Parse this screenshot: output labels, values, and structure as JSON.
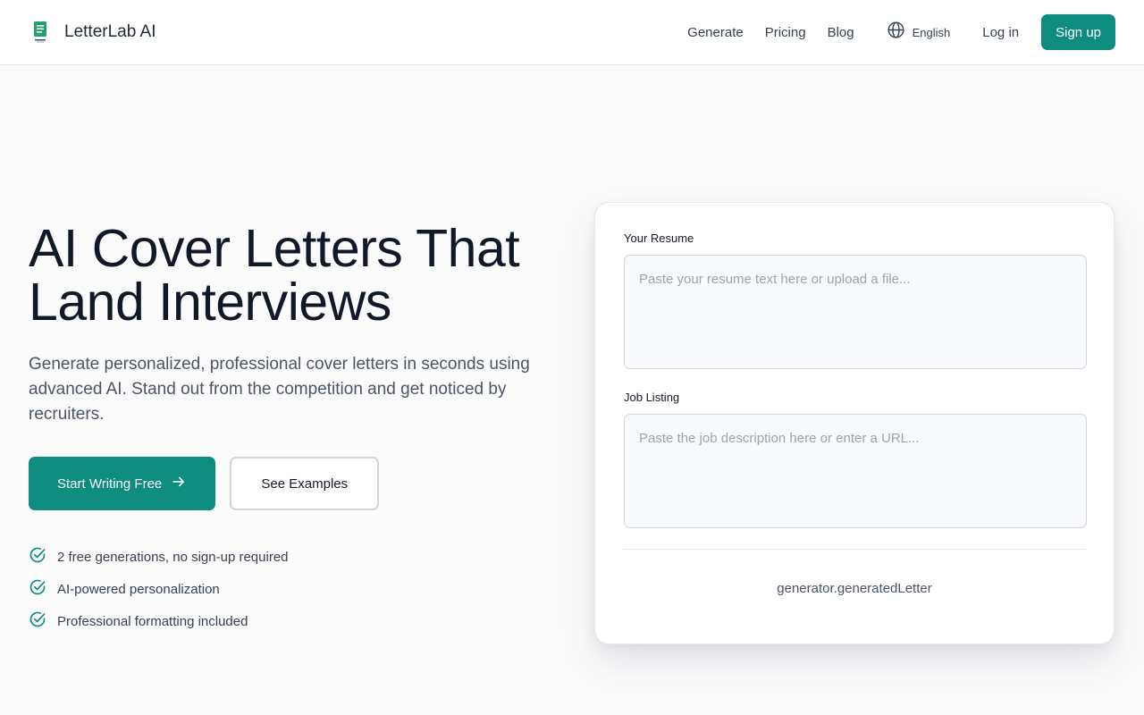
{
  "header": {
    "brand_name": "LetterLab AI",
    "nav": [
      "Generate",
      "Pricing",
      "Blog"
    ],
    "language": "English",
    "login": "Log in",
    "signup": "Sign up"
  },
  "hero": {
    "title_line1": "AI Cover Letters That",
    "title_line2": "Land Interviews",
    "subtitle": "Generate personalized, professional cover letters in seconds using advanced AI. Stand out from the competition and get noticed by recruiters.",
    "cta_primary": "Start Writing Free",
    "cta_secondary": "See Examples",
    "features": [
      "2 free generations, no sign-up required",
      "AI-powered personalization",
      "Professional formatting included"
    ]
  },
  "generator": {
    "resume_label": "Your Resume",
    "resume_placeholder": "Paste your resume text here or upload a file...",
    "job_label": "Job Listing",
    "job_placeholder": "Paste the job description here or enter a URL...",
    "generated_label": "generator.generatedLetter"
  },
  "icons": {
    "logo": "document-logo-icon",
    "language": "globe-icon",
    "cta_arrow": "arrow-right-icon",
    "feature": "check-circle-icon"
  },
  "colors": {
    "accent": "#0d8c7f",
    "text": "#111827",
    "muted": "#4b5563"
  }
}
